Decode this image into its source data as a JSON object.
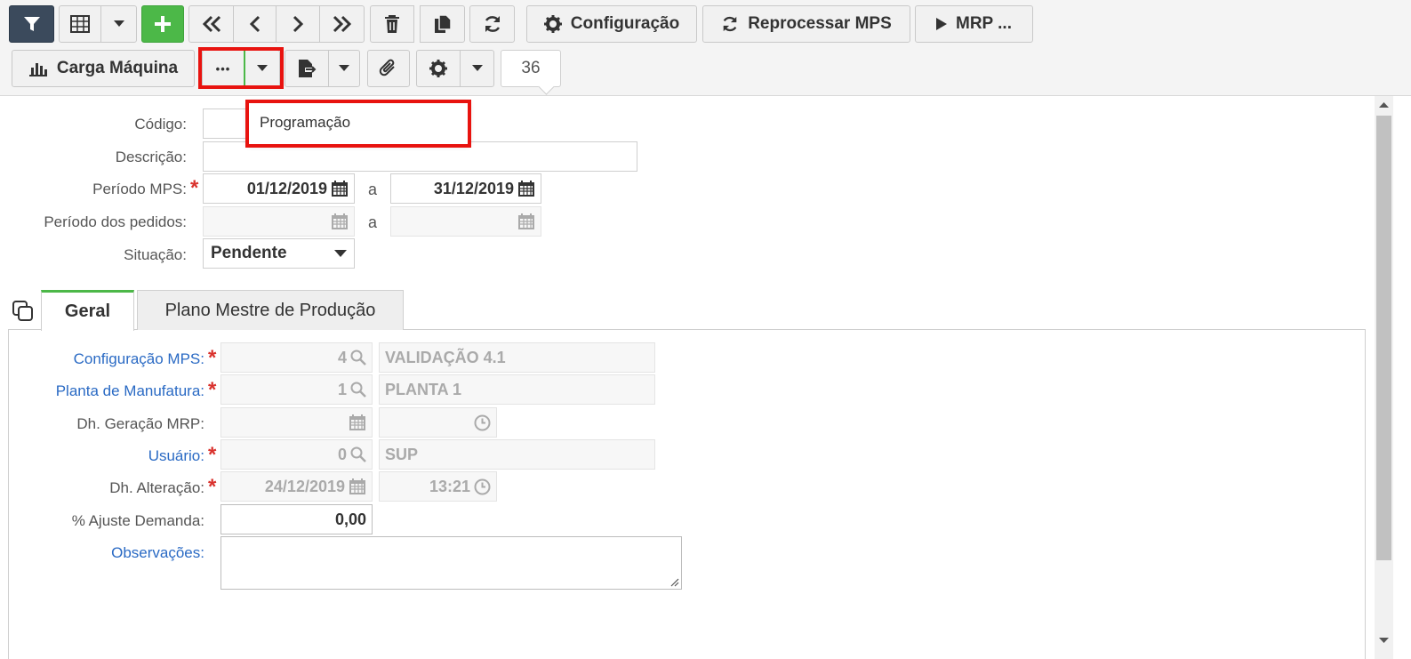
{
  "toolbar": {
    "row1": {
      "filter_icon": "filter-icon",
      "grid_icon": "table-icon",
      "add_icon": "plus-icon",
      "first_icon": "double-chevron-left-icon",
      "prev_icon": "chevron-left-icon",
      "next_icon": "chevron-right-icon",
      "last_icon": "double-chevron-right-icon",
      "delete_icon": "trash-icon",
      "copy_icon": "copy-icon",
      "refresh_icon": "refresh-icon",
      "config_label": "Configuração",
      "reprocess_label": "Reprocessar MPS",
      "mrp_label": "MRP ..."
    },
    "row2": {
      "carga_label": "Carga Máquina",
      "more_label": "•••",
      "counter_value": "36"
    }
  },
  "dropdown": {
    "item_label": "Programação"
  },
  "form": {
    "codigo_label": "Código:",
    "descricao_label": "Descrição:",
    "periodo_mps_label": "Período MPS:",
    "periodo_mps_start": "01/12/2019",
    "periodo_mps_end": "31/12/2019",
    "separator": "a",
    "periodo_pedidos_label": "Período dos pedidos:",
    "situacao_label": "Situação:",
    "situacao_value": "Pendente"
  },
  "tabs": [
    {
      "label": "Geral"
    },
    {
      "label": "Plano Mestre de Produção"
    }
  ],
  "geral": {
    "config_mps_label": "Configuração MPS:",
    "config_mps_code": "4",
    "config_mps_desc": "VALIDAÇÃO 4.1",
    "planta_label": "Planta de Manufatura:",
    "planta_code": "1",
    "planta_desc": "PLANTA 1",
    "dh_geracao_label": "Dh. Geração MRP:",
    "usuario_label": "Usuário:",
    "usuario_code": "0",
    "usuario_desc": "SUP",
    "dh_alteracao_label": "Dh. Alteração:",
    "dh_alteracao_date": "24/12/2019",
    "dh_alteracao_time": "13:21",
    "ajuste_label": "% Ajuste Demanda:",
    "ajuste_value": "0,00",
    "observacoes_label": "Observações:"
  },
  "colors": {
    "accent_green": "#4cb848",
    "filter_dark": "#3b4a5c",
    "highlight_red": "#e8130f",
    "link_blue": "#2a6ac4",
    "required_red": "#d9322d"
  }
}
